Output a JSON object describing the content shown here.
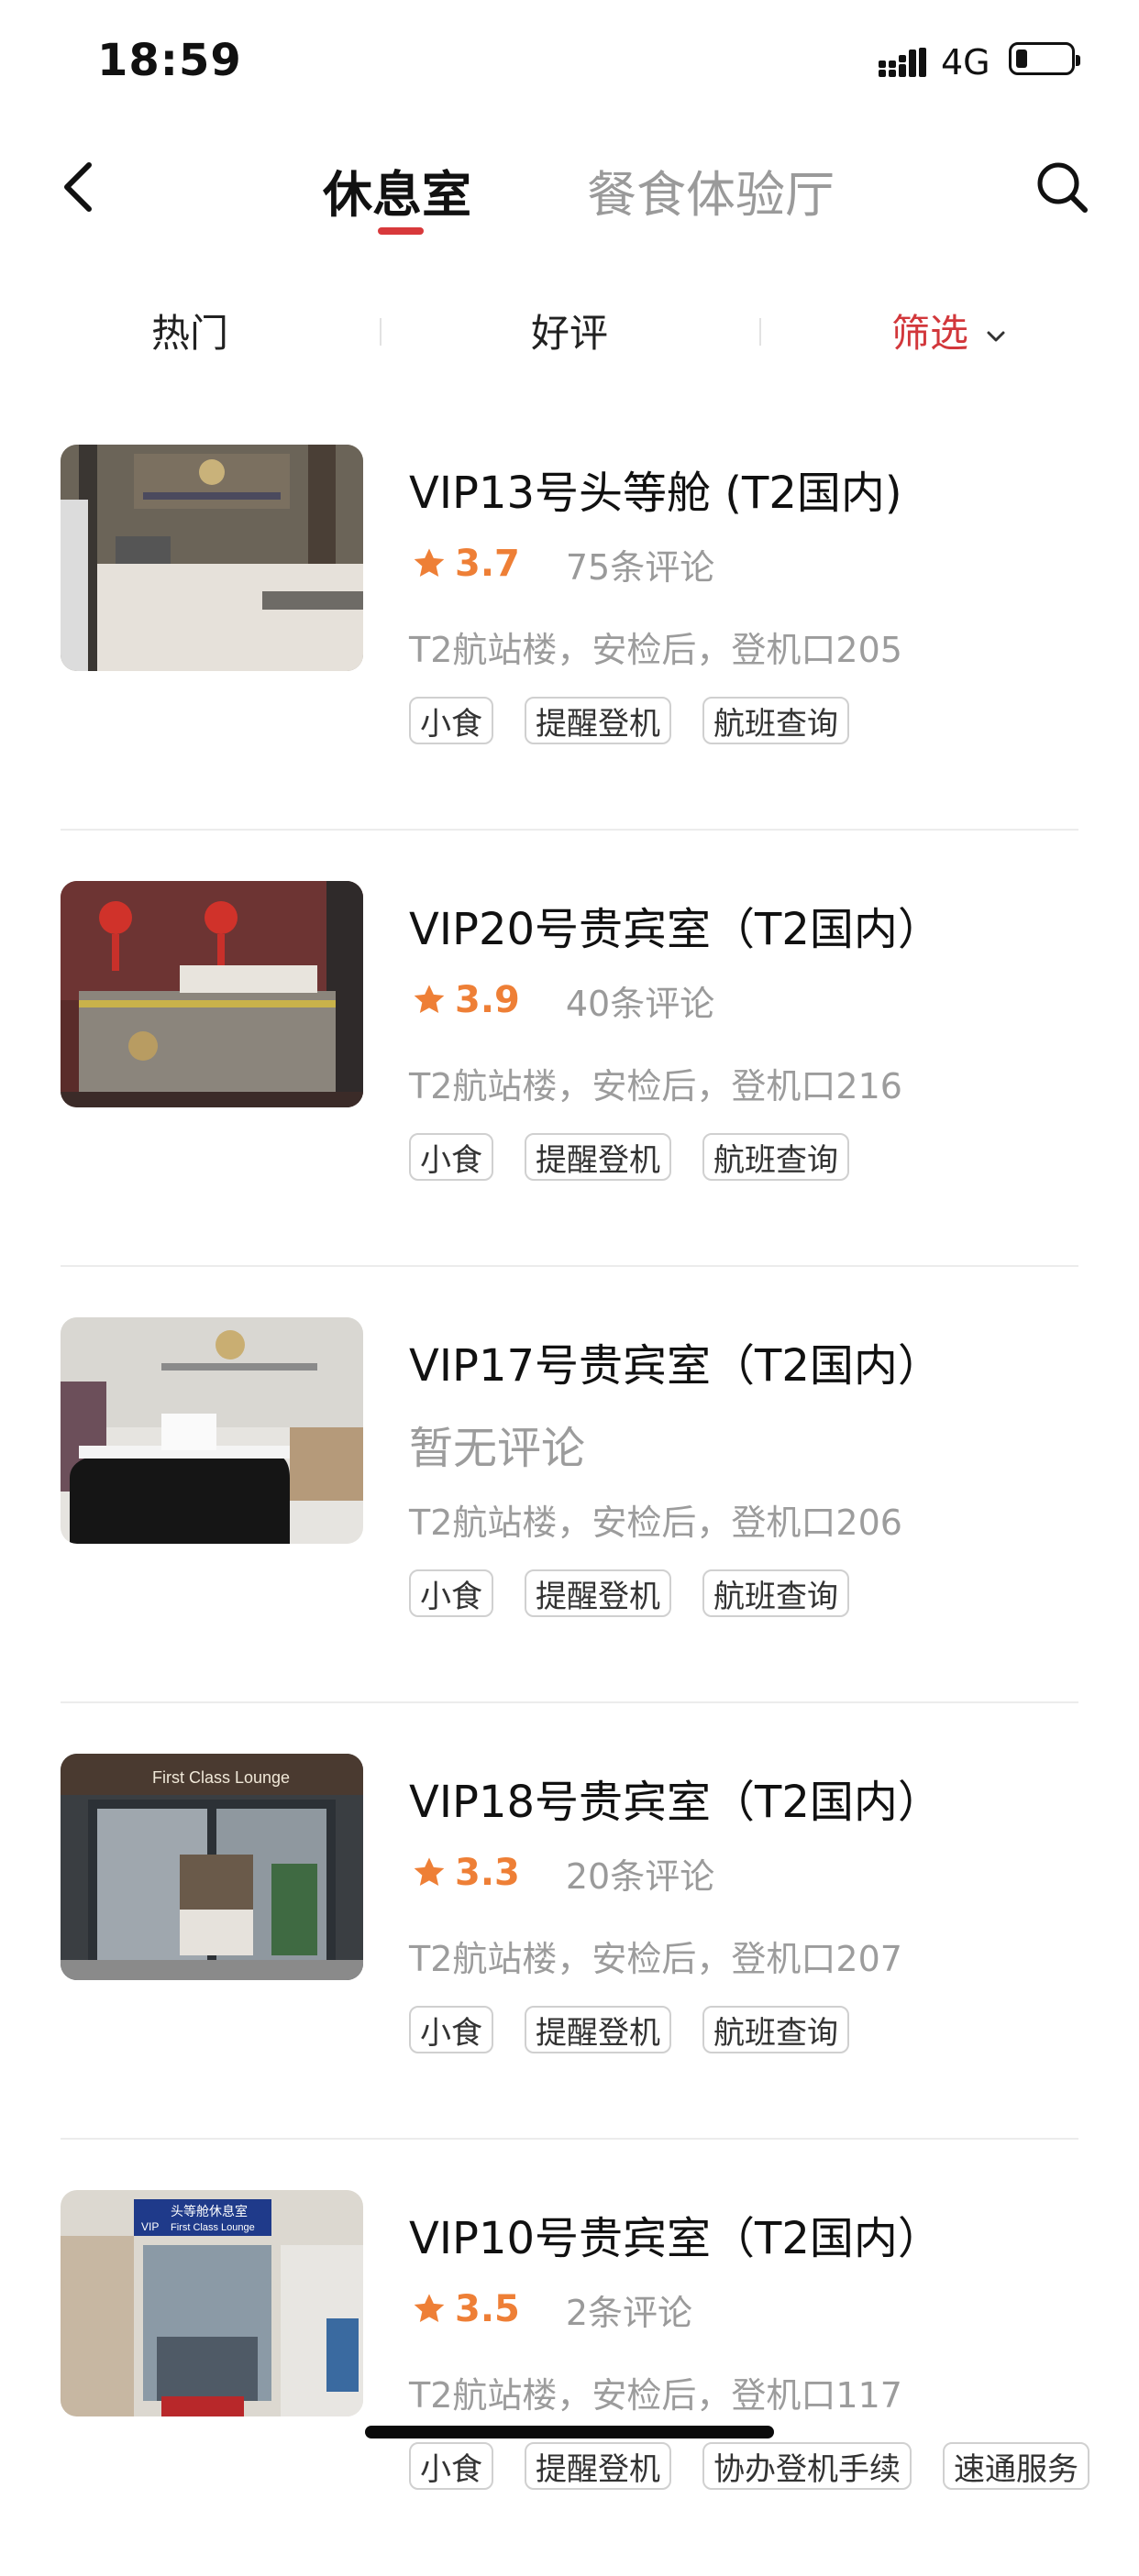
{
  "status_bar": {
    "time": "18:59",
    "network": "4G"
  },
  "nav": {
    "tabs": [
      "休息室",
      "餐食体验厅"
    ],
    "active_tab": 0
  },
  "filters": {
    "items": [
      "热门",
      "好评",
      "筛选"
    ],
    "active": 2
  },
  "colors": {
    "accent_red": "#d2373b",
    "rating_orange": "#ee7f36",
    "muted_gray": "#9a9a9a"
  },
  "lounges": [
    {
      "name": "VIP13号头等舱 (T2国内)",
      "rating": "3.7",
      "reviews": "75条评论",
      "location": "T2航站楼，安检后，登机口205",
      "tags": [
        "小食",
        "提醒登机",
        "航班查询"
      ]
    },
    {
      "name": "VIP20号贵宾室（T2国内）",
      "rating": "3.9",
      "reviews": "40条评论",
      "location": "T2航站楼，安检后，登机口216",
      "tags": [
        "小食",
        "提醒登机",
        "航班查询"
      ]
    },
    {
      "name": "VIP17号贵宾室（T2国内）",
      "no_reviews": "暂无评论",
      "location": "T2航站楼，安检后，登机口206",
      "tags": [
        "小食",
        "提醒登机",
        "航班查询"
      ]
    },
    {
      "name": "VIP18号贵宾室（T2国内）",
      "rating": "3.3",
      "reviews": "20条评论",
      "location": "T2航站楼，安检后，登机口207",
      "tags": [
        "小食",
        "提醒登机",
        "航班查询"
      ]
    },
    {
      "name": "VIP10号贵宾室（T2国内）",
      "rating": "3.5",
      "reviews": "2条评论",
      "location": "T2航站楼，安检后，登机口117",
      "tags": [
        "小食",
        "提醒登机",
        "协办登机手续",
        "速通服务"
      ]
    }
  ],
  "photo_signage": {
    "lounge_3": "First Class Lounge",
    "lounge_4_title": "头等舱休息室",
    "lounge_4_sub": "First Class Lounge",
    "lounge_4_vip": "VIP"
  }
}
